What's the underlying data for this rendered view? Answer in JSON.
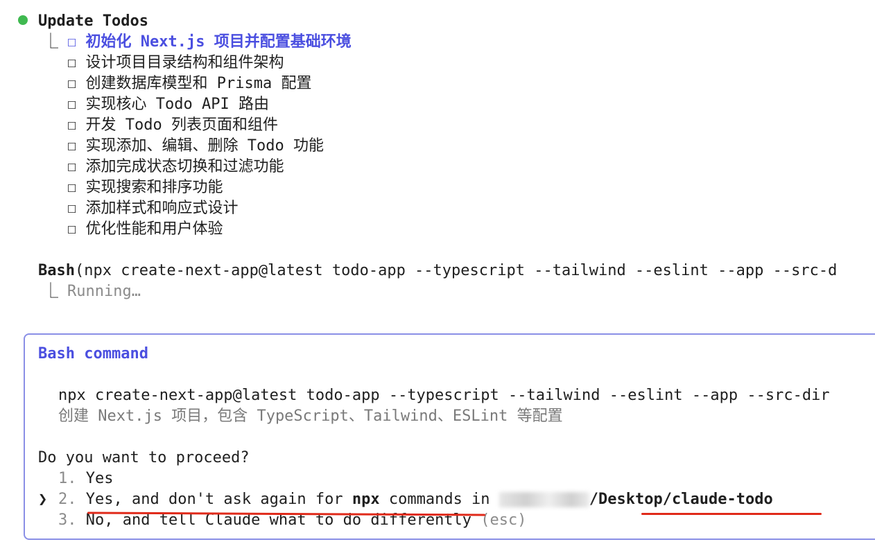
{
  "todos": {
    "header": "Update Todos",
    "connector": "⎿",
    "checkbox_glyph": "☐",
    "items": [
      "初始化 Next.js 项目并配置基础环境",
      "设计项目目录结构和组件架构",
      "创建数据库模型和 Prisma 配置",
      "实现核心 Todo API 路由",
      "开发 Todo 列表页面和组件",
      "实现添加、编辑、删除 Todo 功能",
      "添加完成状态切换和过滤功能",
      "实现搜索和排序功能",
      "添加样式和响应式设计",
      "优化性能和用户体验"
    ]
  },
  "bash_call": {
    "tool": "Bash",
    "args": "(npx create-next-app@latest todo-app --typescript --tailwind --eslint --app --src-d",
    "status": "Running…"
  },
  "dialog": {
    "title": "Bash command",
    "command": "npx create-next-app@latest todo-app --typescript --tailwind --eslint --app --src-dir",
    "description": "创建 Next.js 项目，包含 TypeScript、Tailwind、ESLint 等配置",
    "question": "Do you want to proceed?",
    "pointer": "❯",
    "options": {
      "opt1_num": "1.",
      "opt1": "Yes",
      "opt2_num": "2.",
      "opt2_prefix": "Yes, and don't ask again for ",
      "opt2_bold": "npx",
      "opt2_mid": " commands in ",
      "opt2_path": "/Desktop/claude-todo",
      "opt3_num": "3.",
      "opt3": "No, and tell Claude what to do differently",
      "opt3_esc": "(esc)"
    }
  },
  "colors": {
    "status_dot": "#3fb950",
    "accent": "#4b4fe0",
    "dialog_border": "#8a8fe6",
    "annotation": "#e02a1a"
  }
}
